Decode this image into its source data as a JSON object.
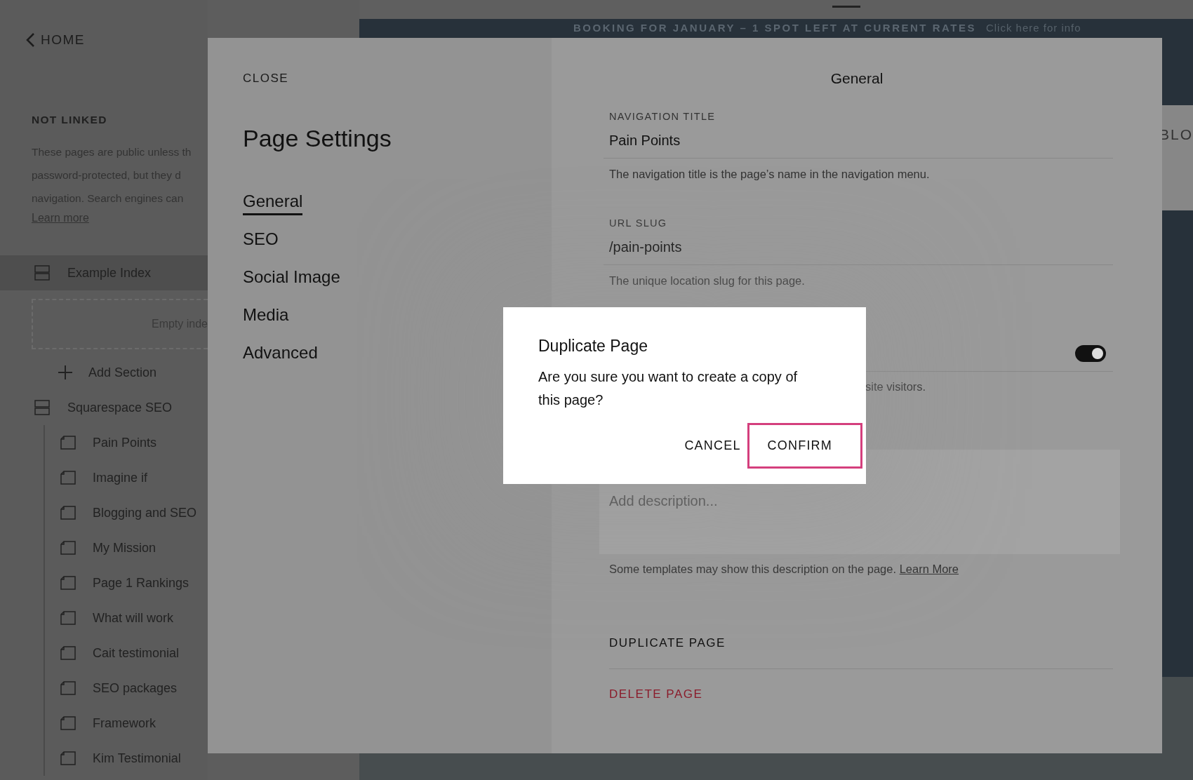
{
  "sidebar": {
    "back_link": "HOME",
    "section_title": "NOT LINKED",
    "description_lines": [
      "These pages are public unless th",
      "password-protected, but they d",
      "navigation. Search engines can"
    ],
    "learn_more": "Learn more",
    "items": [
      {
        "kind": "index",
        "label": "Example Index",
        "selected": true,
        "empty_text": "Empty inde"
      },
      {
        "kind": "add",
        "label": "Add Section"
      },
      {
        "kind": "index",
        "label": "Squarespace SEO",
        "selected": false,
        "children": [
          {
            "label": "Pain Points",
            "selected": false
          },
          {
            "label": "Imagine if",
            "selected": false
          },
          {
            "label": "Blogging and SEO",
            "selected": false
          },
          {
            "label": "My Mission",
            "selected": false
          },
          {
            "label": "Page 1 Rankings",
            "selected": false
          },
          {
            "label": "What will work",
            "selected": false
          },
          {
            "label": "Cait testimonial",
            "selected": false
          },
          {
            "label": "SEO packages",
            "selected": false
          },
          {
            "label": "Framework",
            "selected": false
          },
          {
            "label": "Kim Testimonial",
            "selected": false
          }
        ]
      }
    ]
  },
  "site": {
    "banner_text": "BOOKING FOR JANUARY – 1 SPOT LEFT AT CURRENT RATES",
    "banner_link": "Click here for info",
    "nav_text": "BLO"
  },
  "modal": {
    "close": "CLOSE",
    "title": "Page Settings",
    "tabs": [
      {
        "label": "General",
        "selected": true
      },
      {
        "label": "SEO",
        "selected": false
      },
      {
        "label": "Social Image",
        "selected": false
      },
      {
        "label": "Media",
        "selected": false
      },
      {
        "label": "Advanced",
        "selected": false
      }
    ],
    "pane_title": "General",
    "fields": [
      {
        "label": "NAVIGATION TITLE",
        "value": "Pain Points",
        "help": "The navigation title is the page’s name in the navigation menu."
      },
      {
        "label": "URL SLUG",
        "value": "/pain-points",
        "help": "The unique location slug for this page."
      }
    ],
    "toggle": {
      "on": true,
      "help": "site visitors."
    },
    "description": {
      "placeholder": "Add description...",
      "help": "Some templates may show this description on the page.",
      "link": "Learn More"
    },
    "actions": [
      {
        "label": "DUPLICATE PAGE",
        "kind": "normal"
      },
      {
        "label": "DELETE PAGE",
        "kind": "danger"
      }
    ]
  },
  "dialog": {
    "title": "Duplicate Page",
    "message": "Are you sure you want to create a copy of this page?",
    "buttons": [
      {
        "label": "CANCEL",
        "focused": false
      },
      {
        "label": "CONFIRM",
        "focused": true
      }
    ]
  }
}
